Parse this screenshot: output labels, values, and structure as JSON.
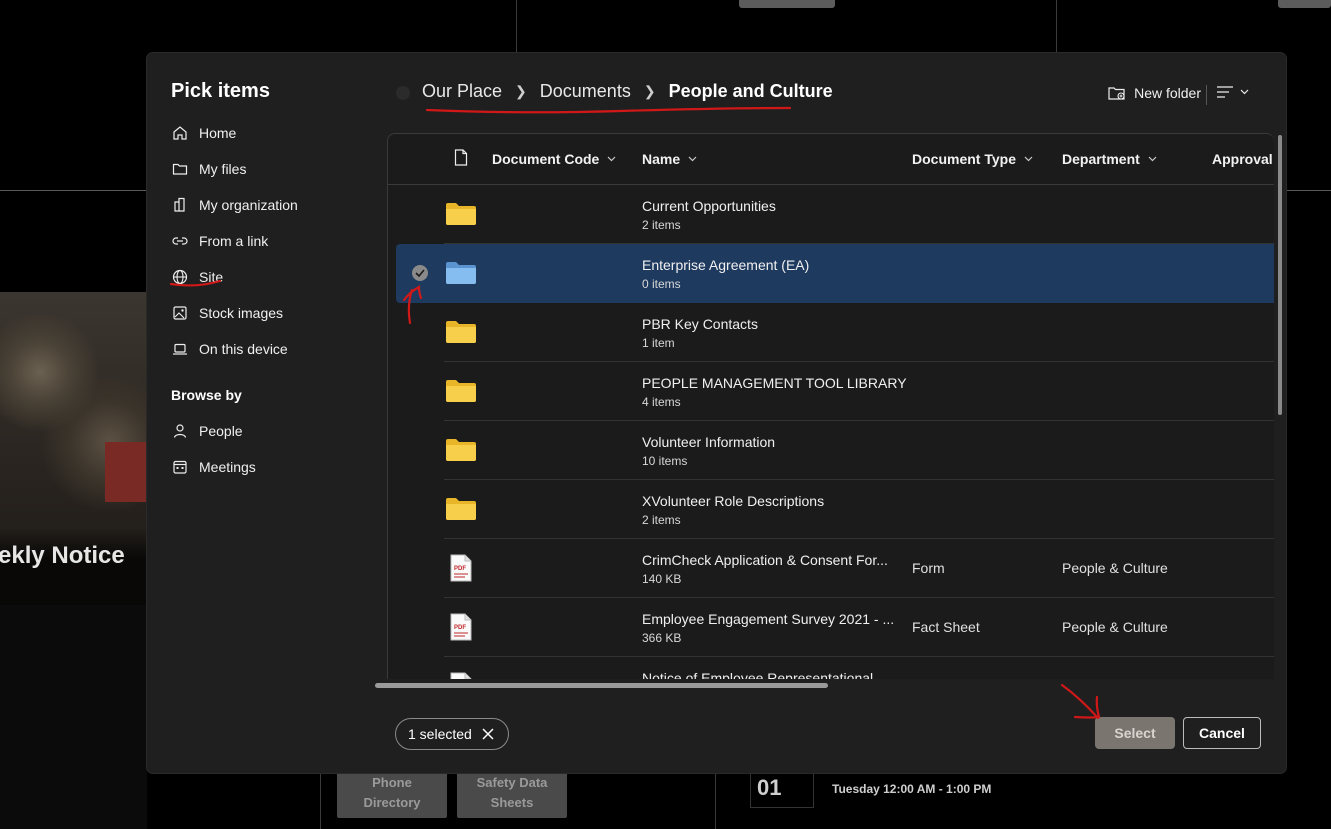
{
  "background": {
    "photo_caption": "ekly Notice",
    "buttons": [
      {
        "label_line1": "Phone",
        "label_line2": "Directory"
      },
      {
        "label_line1": "Safety Data",
        "label_line2": "Sheets"
      }
    ],
    "event_day": "01",
    "event_time": "Tuesday 12:00 AM - 1:00 PM"
  },
  "dialog": {
    "title": "Pick items",
    "nav": [
      {
        "label": "Home",
        "icon": "home-icon"
      },
      {
        "label": "My files",
        "icon": "folder-icon"
      },
      {
        "label": "My organization",
        "icon": "building-icon"
      },
      {
        "label": "From a link",
        "icon": "link-icon"
      },
      {
        "label": "Site",
        "icon": "globe-icon"
      },
      {
        "label": "Stock images",
        "icon": "image-icon"
      },
      {
        "label": "On this device",
        "icon": "laptop-icon"
      }
    ],
    "browse_by_label": "Browse by",
    "browse_by": [
      {
        "label": "People",
        "icon": "person-icon"
      },
      {
        "label": "Meetings",
        "icon": "calendar-icon"
      }
    ],
    "breadcrumb": [
      "Our Place",
      "Documents",
      "People and Culture"
    ],
    "new_folder_label": "New folder",
    "columns": {
      "document_code": "Document Code",
      "name": "Name",
      "document_type": "Document Type",
      "department": "Department",
      "approval": "Approval"
    },
    "rows": [
      {
        "name": "Current Opportunities",
        "meta": "2 items",
        "type": "folder",
        "doctype": "",
        "dept": ""
      },
      {
        "name": "Enterprise Agreement (EA)",
        "meta": "0 items",
        "type": "folder",
        "doctype": "",
        "dept": "",
        "selected": true
      },
      {
        "name": "PBR Key Contacts",
        "meta": "1 item",
        "type": "folder",
        "doctype": "",
        "dept": ""
      },
      {
        "name": "PEOPLE MANAGEMENT TOOL LIBRARY",
        "meta": "4 items",
        "type": "folder",
        "doctype": "",
        "dept": ""
      },
      {
        "name": "Volunteer Information",
        "meta": "10 items",
        "type": "folder",
        "doctype": "",
        "dept": ""
      },
      {
        "name": "XVolunteer Role Descriptions",
        "meta": "2 items",
        "type": "folder",
        "doctype": "",
        "dept": ""
      },
      {
        "name": "CrimCheck Application & Consent For...",
        "meta": "140 KB",
        "type": "pdf",
        "doctype": "Form",
        "dept": "People & Culture"
      },
      {
        "name": "Employee Engagement Survey 2021 - ...",
        "meta": "366 KB",
        "type": "pdf",
        "doctype": "Fact Sheet",
        "dept": "People & Culture"
      },
      {
        "name": "Notice of Employee Representational",
        "meta": "",
        "type": "pdf",
        "doctype": "",
        "dept": ""
      }
    ],
    "selected_count_label": "1 selected",
    "select_label": "Select",
    "cancel_label": "Cancel"
  },
  "colors": {
    "selected_row": "#1e3a5f",
    "folder_yellow": "#f5c842",
    "folder_blue": "#7ab3e8",
    "annotation_red": "#d01818"
  }
}
